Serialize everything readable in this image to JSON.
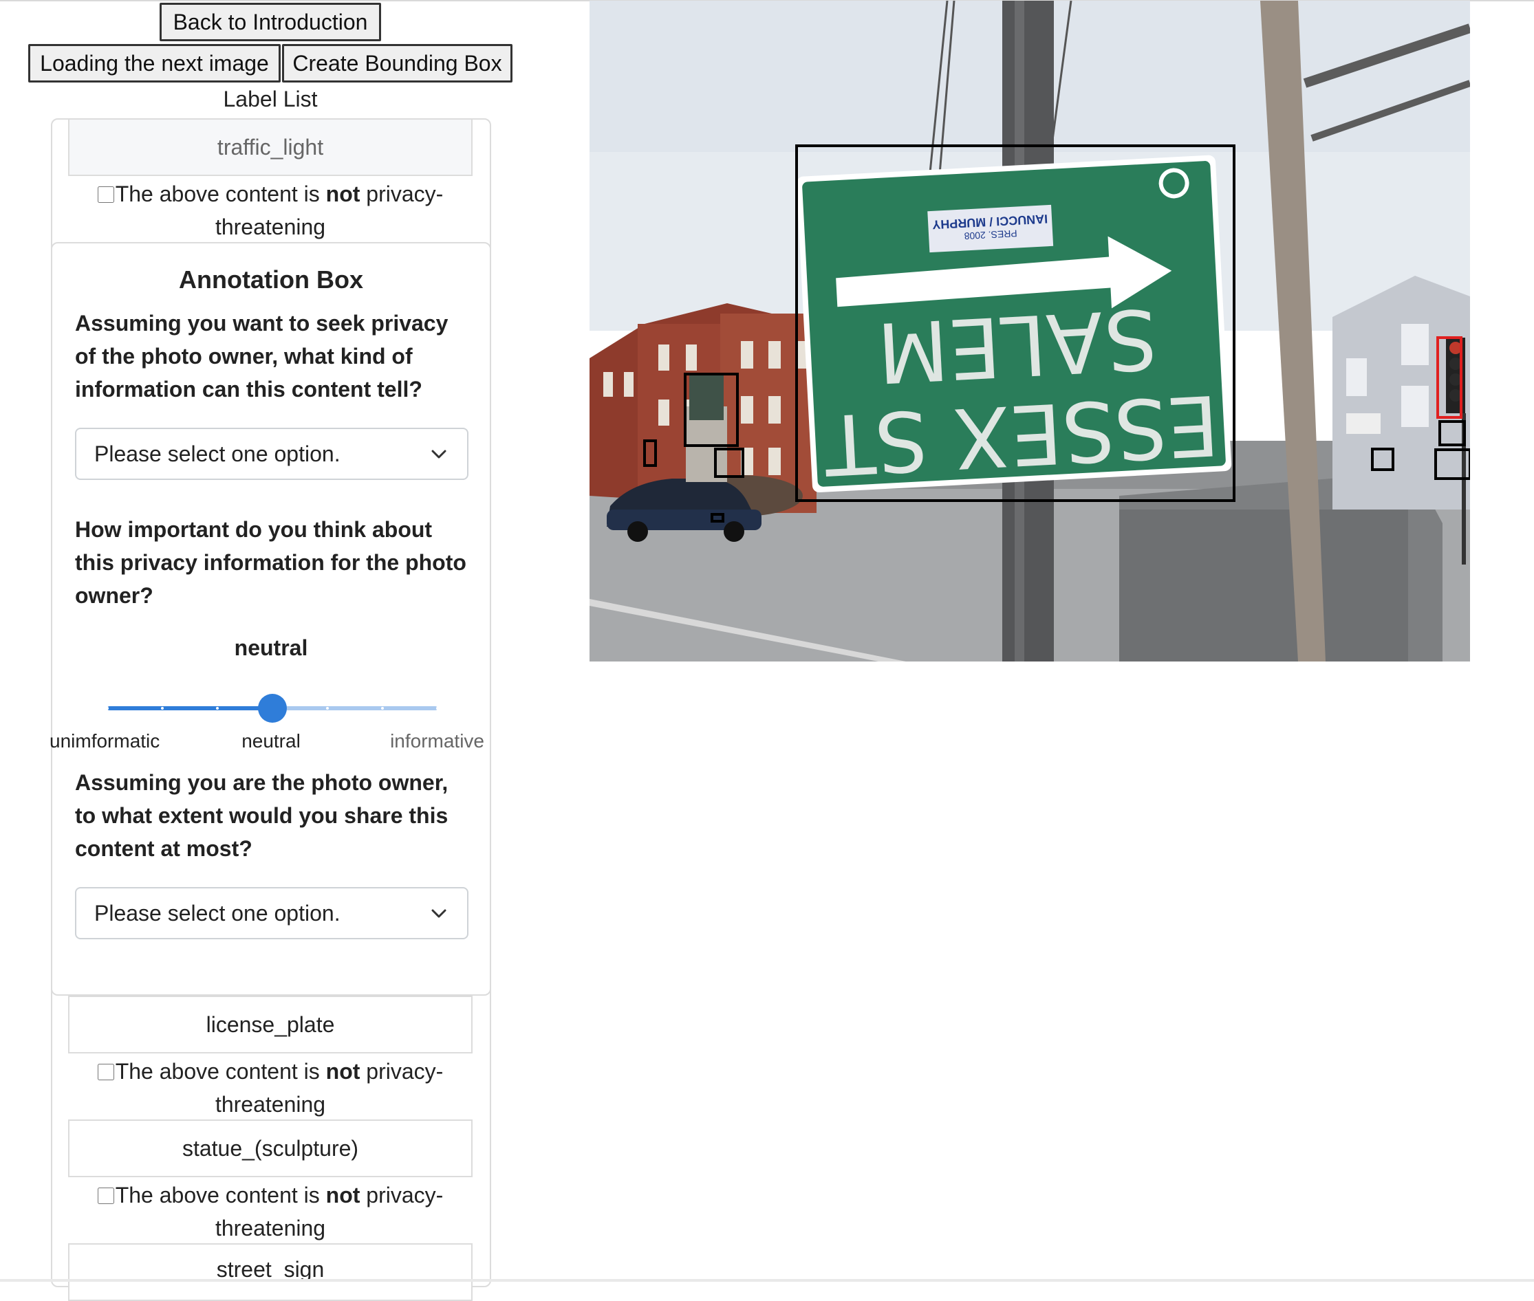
{
  "buttons": {
    "back": "Back to Introduction",
    "next": "Loading the next image",
    "create": "Create Bounding Box"
  },
  "label_list_title": "Label List",
  "labels": [
    {
      "name": "traffic_light",
      "privacy_text_before": "The above content is ",
      "privacy_text_bold": "not",
      "privacy_text_after": " privacy-threatening",
      "checked": false,
      "active": true
    },
    {
      "name": "license_plate",
      "privacy_text_before": "The above content is ",
      "privacy_text_bold": "not",
      "privacy_text_after": " privacy-threatening",
      "checked": false,
      "active": false
    },
    {
      "name": "statue_(sculpture)",
      "privacy_text_before": "The above content is ",
      "privacy_text_bold": "not",
      "privacy_text_after": " privacy-threatening",
      "checked": false,
      "active": false
    },
    {
      "name": "street_sign",
      "active": false
    }
  ],
  "annotation": {
    "title": "Annotation Box",
    "q1": "Assuming you want to seek privacy of the photo owner, what kind of information can this content tell?",
    "q1_select": "Please select one option.",
    "q2": "How important do you think about this privacy information for the photo owner?",
    "slider": {
      "value_label": "neutral",
      "value_fraction": 0.5,
      "steps": 6,
      "min_label": "unimformatic",
      "mid_label": "neutral",
      "max_label": "informative"
    },
    "q3": "Assuming you are the photo owner, to what extent would you share this content at most?",
    "q3_select": "Please select one option."
  },
  "photo": {
    "sign_text_line1": "SALEM",
    "sign_text_line2": "ESSEX ST",
    "sticker_text_1": "IANUCCI / MURPHY",
    "sticker_text_2": "PRES. 2008",
    "colors": {
      "sign_green": "#2a7d5a",
      "selected_box": "#e02020",
      "box": "#000000"
    }
  }
}
